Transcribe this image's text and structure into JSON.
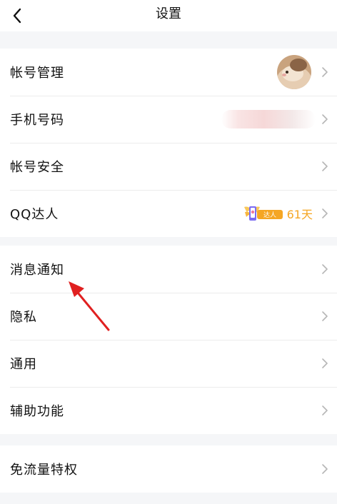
{
  "nav": {
    "title": "设置"
  },
  "account_group": {
    "items": [
      {
        "label": "帐号管理"
      },
      {
        "label": "手机号码"
      },
      {
        "label": "帐号安全"
      },
      {
        "label": "QQ达人",
        "badge_text": "达人",
        "days": "61天"
      }
    ]
  },
  "general_group": {
    "items": [
      {
        "label": "消息通知"
      },
      {
        "label": "隐私"
      },
      {
        "label": "通用"
      },
      {
        "label": "辅助功能"
      }
    ]
  },
  "perk_group": {
    "items": [
      {
        "label": "免流量特权"
      }
    ]
  },
  "icons": {
    "back": "back-chevron-icon",
    "row_arrow": "chevron-right-icon",
    "annotation": "red-pointer-arrow"
  },
  "colors": {
    "background": "#f5f6f8",
    "card": "#ffffff",
    "divider": "#ececec",
    "chevron": "#b6b6b6",
    "days_text": "#f5a623",
    "annotation_arrow": "#e02020"
  }
}
